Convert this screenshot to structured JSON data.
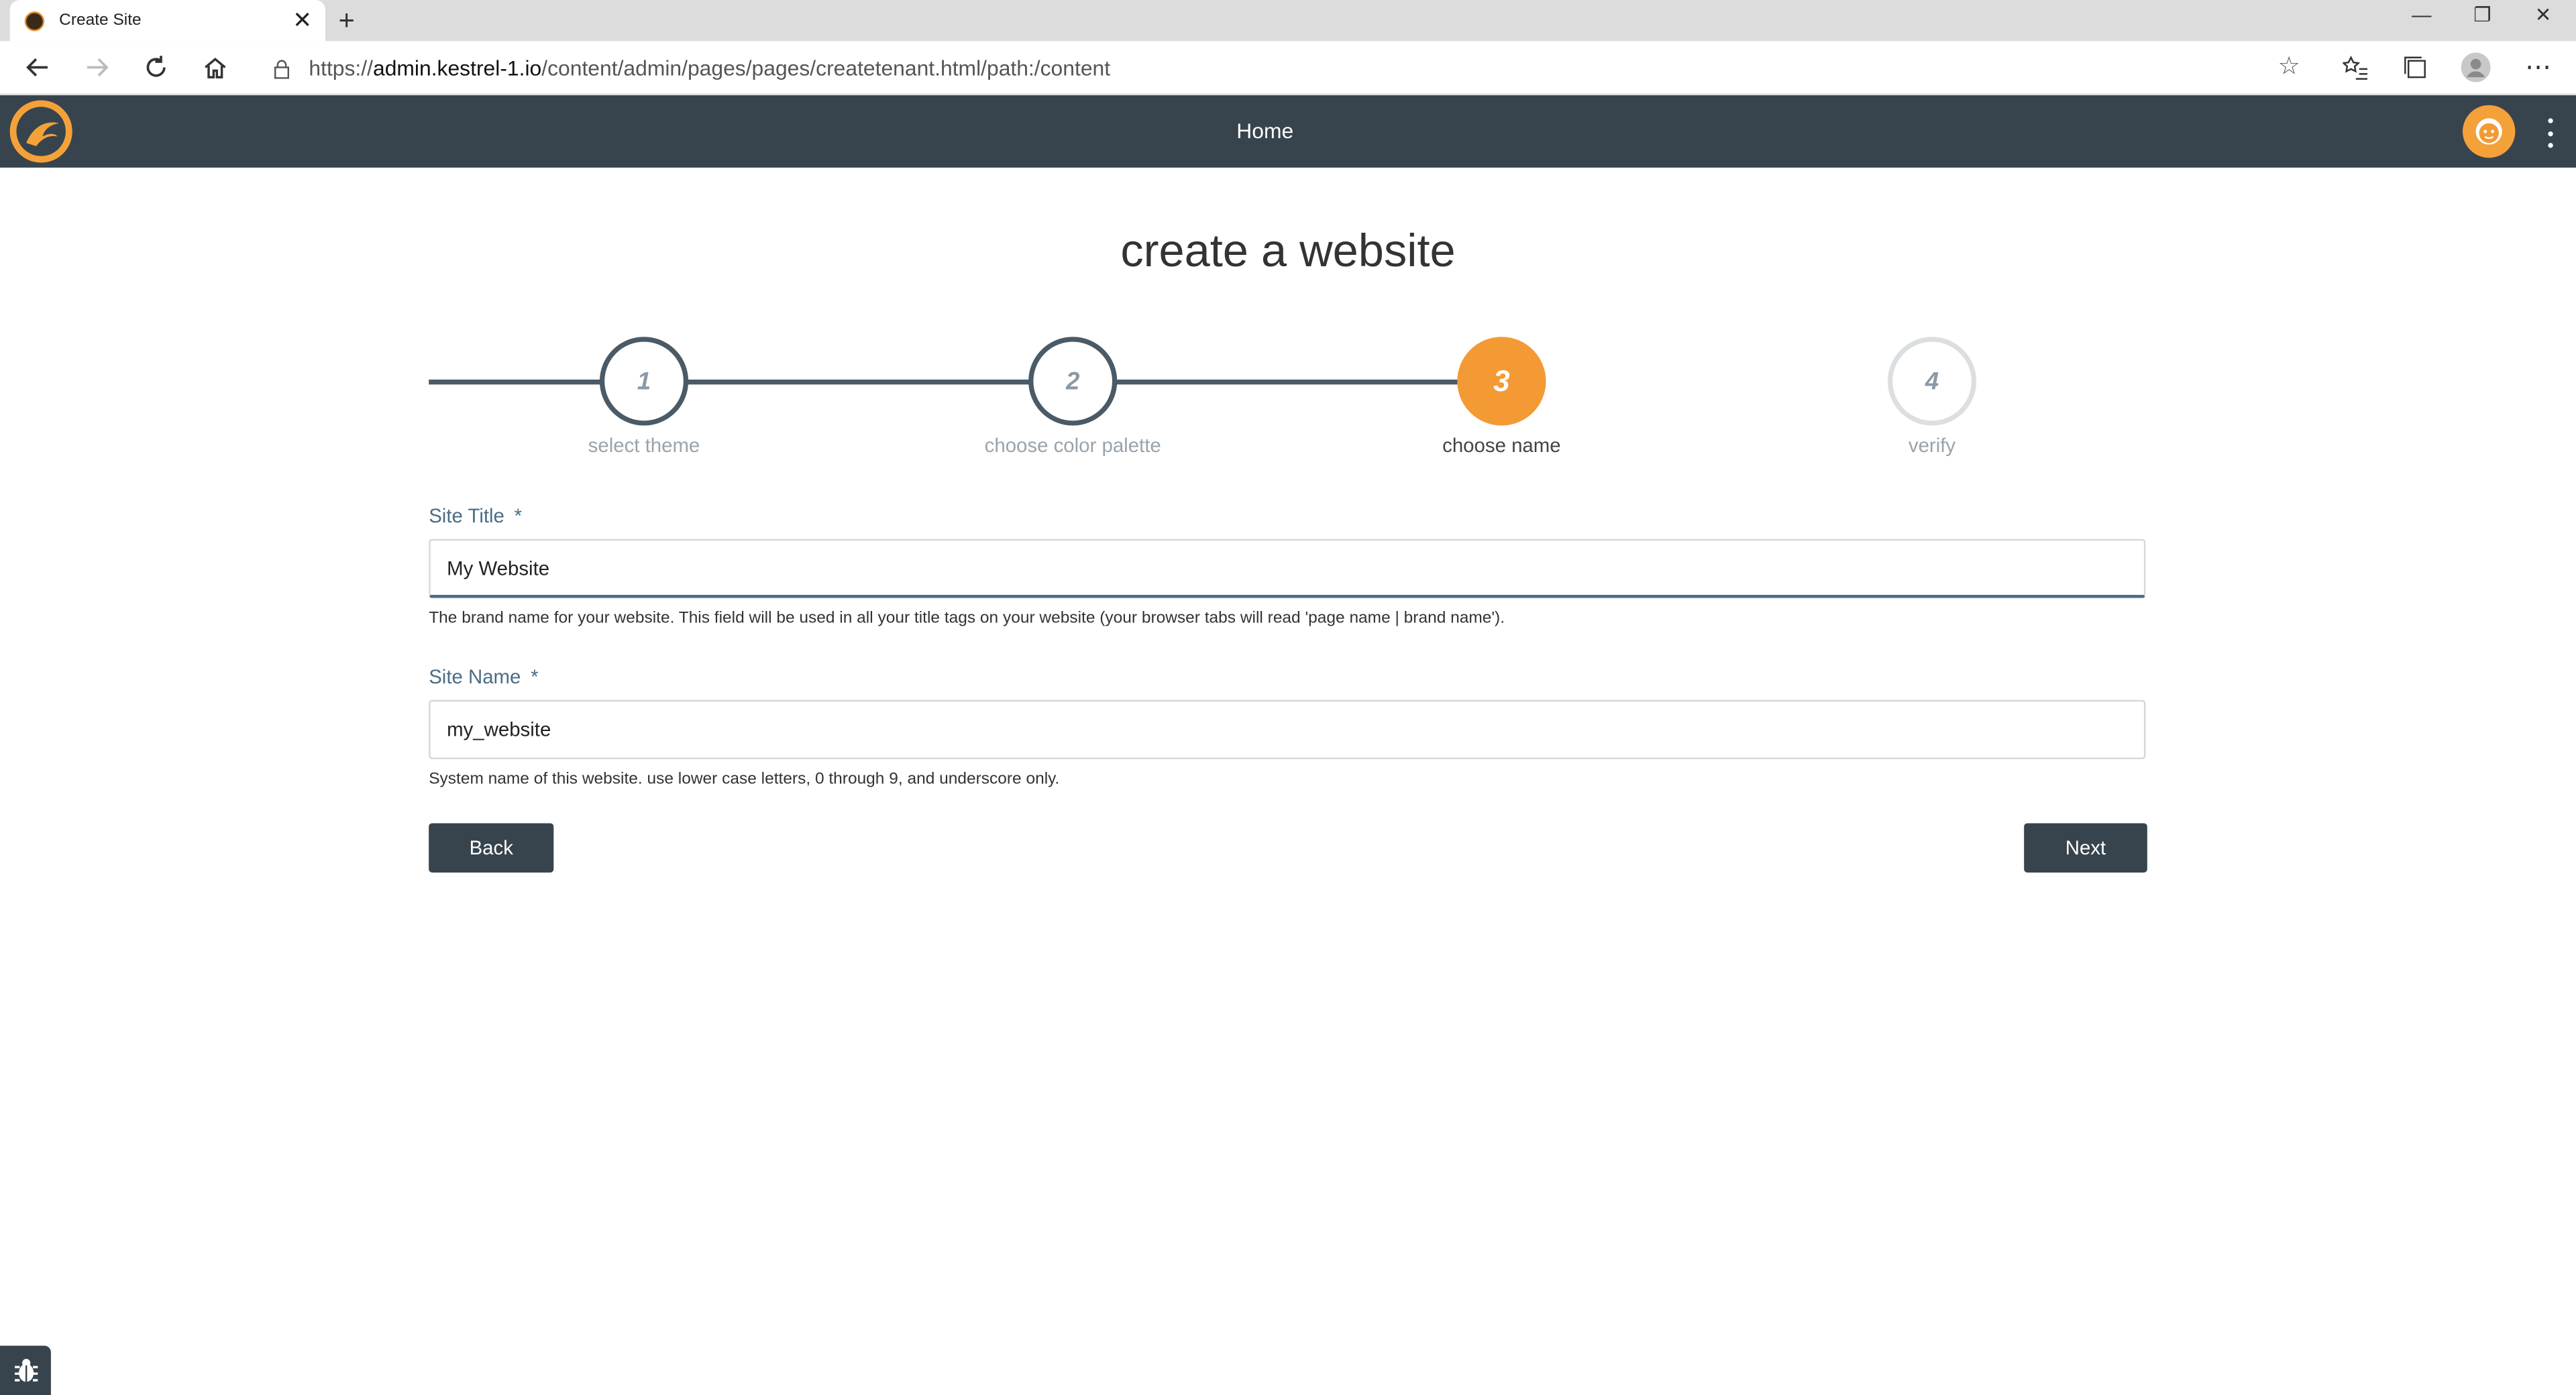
{
  "browser": {
    "tab_title": "Create Site",
    "url_prefix": "https://",
    "url_host": "admin.kestrel-1.io",
    "url_path": "/content/admin/pages/pages/createtenant.html/path:/content"
  },
  "appbar": {
    "home_label": "Home",
    "colors": {
      "bar": "#38444d",
      "accent": "#f39a35"
    }
  },
  "page": {
    "title": "create a website"
  },
  "stepper": {
    "steps": [
      {
        "number": "1",
        "label": "select theme",
        "state": "done"
      },
      {
        "number": "2",
        "label": "choose color palette",
        "state": "done"
      },
      {
        "number": "3",
        "label": "choose name",
        "state": "active"
      },
      {
        "number": "4",
        "label": "verify",
        "state": "todo"
      }
    ]
  },
  "form": {
    "site_title": {
      "label": "Site Title",
      "required_marker": "*",
      "value": "My Website",
      "help": "The brand name for your website. This field will be used in all your title tags on your website (your browser tabs will read 'page name | brand name')."
    },
    "site_name": {
      "label": "Site Name",
      "required_marker": "*",
      "value": "my_website",
      "help": "System name of this website. use lower case letters, 0 through 9, and underscore only."
    },
    "back_label": "Back",
    "next_label": "Next"
  }
}
